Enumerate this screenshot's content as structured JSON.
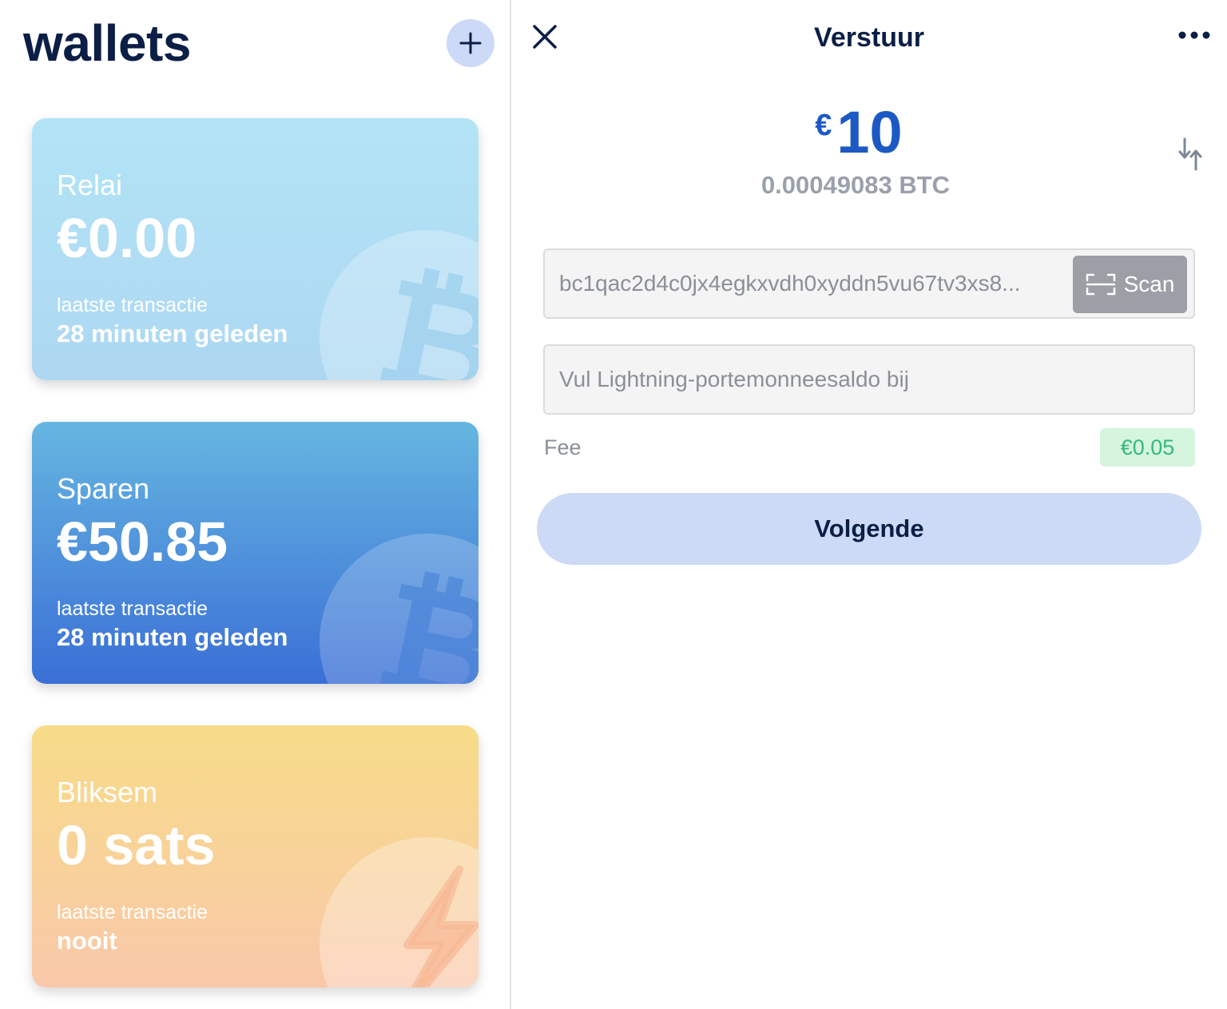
{
  "wallets_panel": {
    "title": "wallets",
    "add_icon": "plus-icon",
    "cards": [
      {
        "name": "Relai",
        "balance": "€0.00",
        "latest_label": "laatste transactie",
        "latest_value": "28 minuten geleden",
        "icon": "bitcoin-icon",
        "colors": [
          "#b2e4f6",
          "#aed7f2"
        ]
      },
      {
        "name": "Sparen",
        "balance": "€50.85",
        "latest_label": "laatste transactie",
        "latest_value": "28 minuten geleden",
        "icon": "bitcoin-icon",
        "colors": [
          "#66b6e1",
          "#3a6fd6"
        ]
      },
      {
        "name": "Bliksem",
        "balance": "0 sats",
        "latest_label": "laatste transactie",
        "latest_value": "nooit",
        "icon": "lightning-icon",
        "colors": [
          "#f7dc88",
          "#f9c8aa"
        ]
      }
    ]
  },
  "send_panel": {
    "title": "Verstuur",
    "close_icon": "close-icon",
    "more_icon": "more-horizontal-icon",
    "amount": {
      "currency_symbol": "€",
      "value": "10",
      "btc": "0.00049083 BTC",
      "switch_icon": "swap-vertical-icon"
    },
    "address": {
      "value": "bc1qac2d4c0jx4egkxvdh0xyddn5vu67tv3xs8...",
      "scan_label": "Scan",
      "scan_icon": "scan-icon"
    },
    "memo": {
      "placeholder": "Vul Lightning-portemonneesaldo bij"
    },
    "fee": {
      "label": "Fee",
      "value": "€0.05"
    },
    "next_label": "Volgende"
  },
  "colors": {
    "navy": "#0b1e46",
    "accent_blue": "#1d59c4",
    "light_blue": "#ccdaf5",
    "fee_green": "#35b97c",
    "fee_bg": "#d5f5de"
  }
}
